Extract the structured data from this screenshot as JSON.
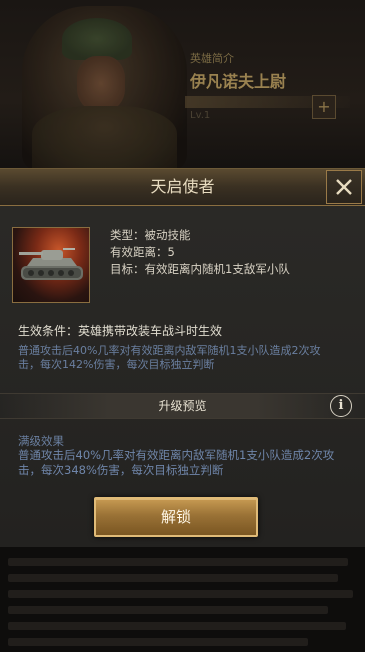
{
  "background": {
    "title_sub": "英雄简介",
    "title_main": "伊凡诺夫上尉",
    "level": "Lv.1"
  },
  "dialog": {
    "title": "天启使者",
    "close_icon": "close-icon",
    "skill": {
      "icon": "tank-icon",
      "type": "类型：被动技能",
      "range": "有效距离：5",
      "target": "目标：有效距离内随机1支敌军小队"
    },
    "condition": {
      "text": "生效条件：英雄携带改装车战斗时生效",
      "desc": "普通攻击后40%几率对有效距离内敌军随机1支小队造成2次攻击，每次142%伤害，每次目标独立判断"
    },
    "upgrade": {
      "title": "升级预览",
      "info_icon": "info-icon",
      "max_label": "满级效果",
      "max_desc": "普通攻击后40%几率对有效距离内敌军随机1支小队造成2次攻击，每次348%伤害，每次目标独立判断"
    },
    "unlock_label": "解锁"
  },
  "colors": {
    "accent_gold": "#c79a52",
    "desc_blue": "#6a7fa0"
  }
}
